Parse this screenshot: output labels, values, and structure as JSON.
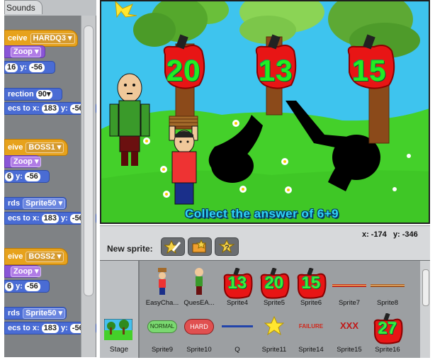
{
  "tabs": {
    "sounds": "Sounds"
  },
  "scripts": {
    "block1_label": "ceive",
    "block1_value": "HARDQ3",
    "block2_value": "Zoop",
    "block3_x": "16",
    "block3_y_label": "y:",
    "block3_y": "-56",
    "block4_label": "rection",
    "block4_value": "90",
    "block5_label": "ecs to x:",
    "block5_x": "183",
    "block5_y_label": "y:",
    "block5_y": "-56",
    "block6_label": "eive",
    "block6_value": "BOSS1",
    "block7_value": "Zoop",
    "block8_x": "6",
    "block8_y_label": "y:",
    "block8_y": "-56",
    "block9_label": "rds",
    "block9_value": "Sprite50",
    "block10_label": "ecs to x:",
    "block10_x": "183",
    "block10_y_label": "y:",
    "block10_y": "-56",
    "block11_label": "eive",
    "block11_value": "BOSS2",
    "block12_value": "Zoop",
    "block13_x": "6",
    "block13_y_label": "y:",
    "block13_y": "-56",
    "block14_label": "rds",
    "block14_value": "Sprite50",
    "block15_label": "ecs to x:",
    "block15_x": "183",
    "block15_y_label": "y:",
    "block15_y": "-56"
  },
  "stage": {
    "answers": [
      "20",
      "13",
      "15"
    ],
    "prompt": "Collect the answer of 6+9"
  },
  "sprite_header": {
    "new_sprite_label": "New sprite:",
    "x_label": "x:",
    "x_value": "-174",
    "y_label": "y:",
    "y_value": "-346"
  },
  "stage_label": "Stage",
  "sprites": [
    {
      "name": "EasyCha..."
    },
    {
      "name": "QuesEA..."
    },
    {
      "name": "Sprite4",
      "number": "13"
    },
    {
      "name": "Sprite5",
      "number": "20"
    },
    {
      "name": "Sprite6",
      "number": "15"
    },
    {
      "name": "Sprite7"
    },
    {
      "name": "Sprite8"
    },
    {
      "name": "Sprite9",
      "badge": "NORMAL"
    },
    {
      "name": "Sprite10",
      "badge": "HARD"
    },
    {
      "name": "Q"
    },
    {
      "name": "Sprite11"
    },
    {
      "name": "Sprite14",
      "badge": "FAILURE"
    },
    {
      "name": "Sprite15",
      "badge": "XXX"
    },
    {
      "name": "Sprite16",
      "number": "27"
    }
  ],
  "colors": {
    "control": "#e7a21c",
    "looks": "#8a55d7",
    "motion": "#4a6cd4",
    "sky": "#3ec4ee",
    "grass": "#44d02a",
    "answer_text": "#22ee22"
  }
}
